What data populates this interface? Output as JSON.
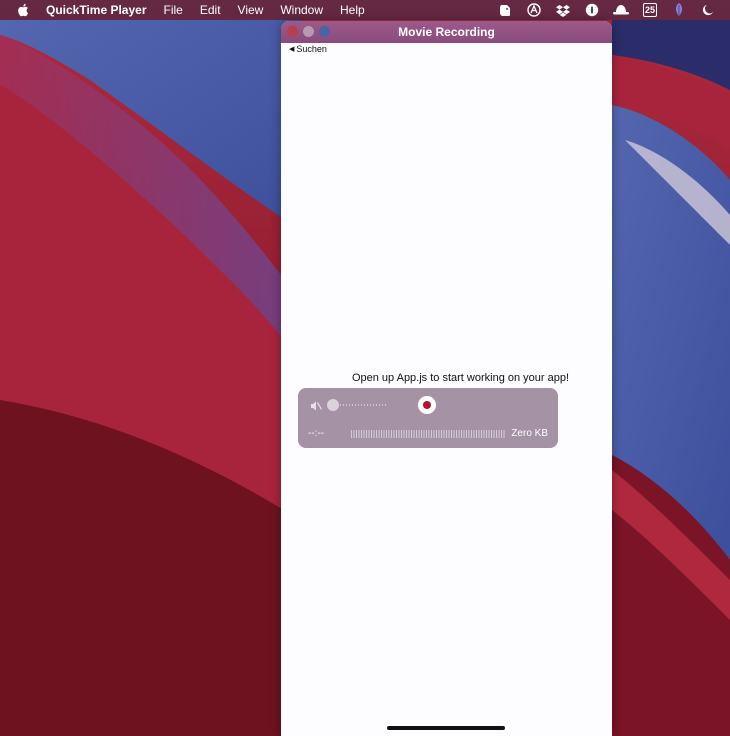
{
  "menubar": {
    "app_name": "QuickTime Player",
    "menus": [
      "File",
      "Edit",
      "View",
      "Window",
      "Help"
    ],
    "status_icons": [
      "evernote-icon",
      "altair-icon",
      "dropbox-icon",
      "1password-icon",
      "hat-icon",
      "calendar-icon",
      "feather-icon",
      "moon-icon"
    ],
    "calendar_day": "25"
  },
  "window": {
    "title": "Movie Recording",
    "back_link": "Suchen",
    "app_message": "Open up App.js to start working on your app!"
  },
  "recorder": {
    "time": "--:--",
    "file_size": "Zero KB",
    "record_color": "#b3142a"
  }
}
